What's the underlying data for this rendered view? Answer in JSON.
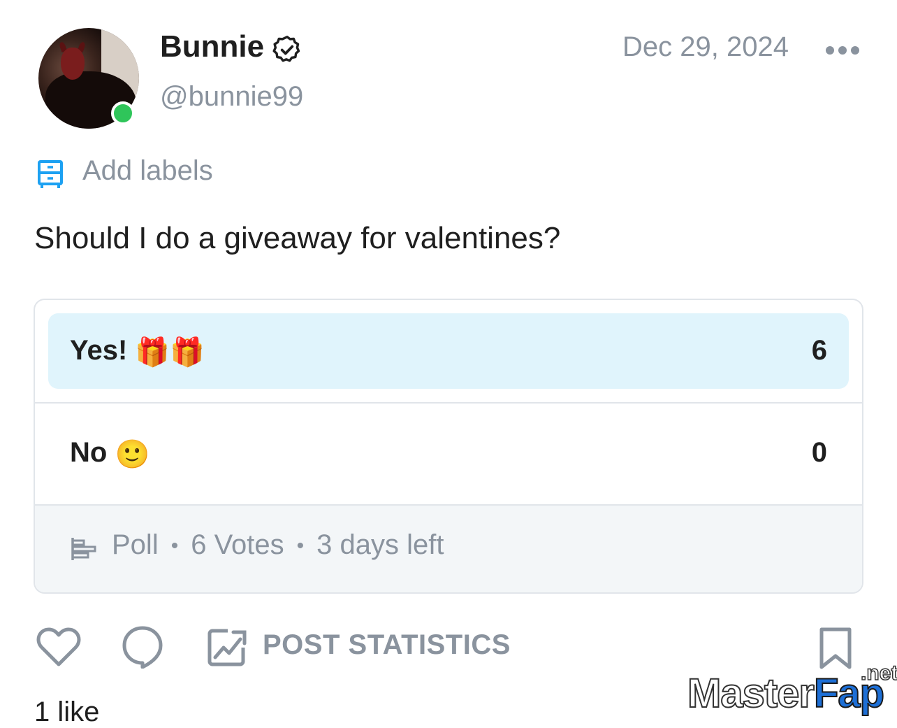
{
  "header": {
    "display_name": "Bunnie",
    "handle": "@bunnie99",
    "date": "Dec 29, 2024",
    "online_color": "#2fc55a"
  },
  "labels": {
    "text": "Add labels",
    "icon": "labels-icon",
    "color": "#1da1f2"
  },
  "post": {
    "text": "Should I do a giveaway for valentines?"
  },
  "poll": {
    "options": [
      {
        "label": "Yes!",
        "emoji": "🎁🎁",
        "count": "6",
        "selected_fill": true
      },
      {
        "label": "No",
        "emoji": "🙂",
        "count": "0",
        "selected_fill": false
      }
    ],
    "footer": {
      "type": "Poll",
      "votes": "6 Votes",
      "time_left": "3 days left"
    }
  },
  "actions": {
    "statistics_label": "POST STATISTICS"
  },
  "likes": "1 like",
  "watermark": {
    "main": "Master",
    "accent": "Fap",
    "suffix": ".net"
  }
}
